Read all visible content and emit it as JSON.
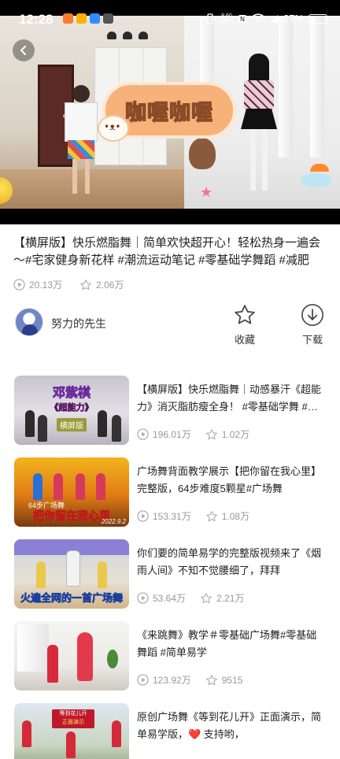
{
  "status_bar": {
    "time": "12:28",
    "net_speed_value": "9.60",
    "net_speed_unit": "MB/s",
    "battery": "27%"
  },
  "video": {
    "overlay_text": "咖喔咖喔",
    "title": "【横屏版】快乐燃脂舞｜简单欢快超开心！轻松热身一遍会～#宅家健身新花样 #潮流运动笔记 #零基础学舞蹈 #减肥",
    "plays": "20.13万",
    "likes": "2.06万"
  },
  "author": {
    "name": "努力的先生"
  },
  "actions": {
    "collect_label": "收藏",
    "download_label": "下载"
  },
  "recommended": [
    {
      "title": "【横屏版】快乐燃脂舞｜动感暴汗《超能力》消灭脂肪瘦全身！ #零基础学舞 #宅家健身新花样",
      "plays": "196.01万",
      "likes": "1.02万",
      "thumb_title": "邓紫棋",
      "thumb_subtitle": "《超能力》",
      "thumb_badge": "横屏版"
    },
    {
      "title": "广场舞背面教学展示【把你留在我心里】完整版，64步难度5颗星#广场舞",
      "plays": "153.31万",
      "likes": "1.08万",
      "thumb_caption": "把你留在我心里",
      "thumb_tag": "64步广场舞",
      "thumb_date": "2022.9.2"
    },
    {
      "title": "你们要的简单易学的完整版视频来了《烟雨人间》不知不觉腰细了，拜拜",
      "plays": "53.64万",
      "likes": "2.21万",
      "thumb_caption": "火遍全网的一首广场舞"
    },
    {
      "title": "《来跳舞》教学＃零基础广场舞#零基础舞蹈 #简单易学",
      "plays": "123.92万",
      "likes": "9515"
    },
    {
      "title": "原创广场舞《等到花儿开》正面演示，简单易学版，❤️ 支持哟，",
      "plays": "",
      "likes": "",
      "thumb_caption": "等到花儿开",
      "thumb_sub": "正面演示"
    }
  ]
}
